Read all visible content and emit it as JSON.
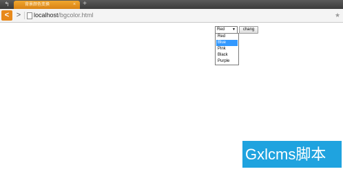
{
  "browser": {
    "tab_title": "背景颜色变换",
    "tab_close": "×",
    "new_tab": "+",
    "back_glyph": "<",
    "forward_glyph": ">",
    "url_host": "localhost",
    "url_path": "/bgcolor.html",
    "star_glyph": "★"
  },
  "page": {
    "select": {
      "value": "Red",
      "caret": "▼",
      "options": [
        "Red",
        "Blue",
        "Pink",
        "Black",
        "Purple"
      ],
      "highlighted_index": 1,
      "highlight_color": "#3399ff"
    },
    "change_button_label": "chang"
  },
  "watermark": {
    "text": "Gxlcms脚本",
    "color": "#1fa3df"
  },
  "colors": {
    "accent": "#e8891a"
  }
}
